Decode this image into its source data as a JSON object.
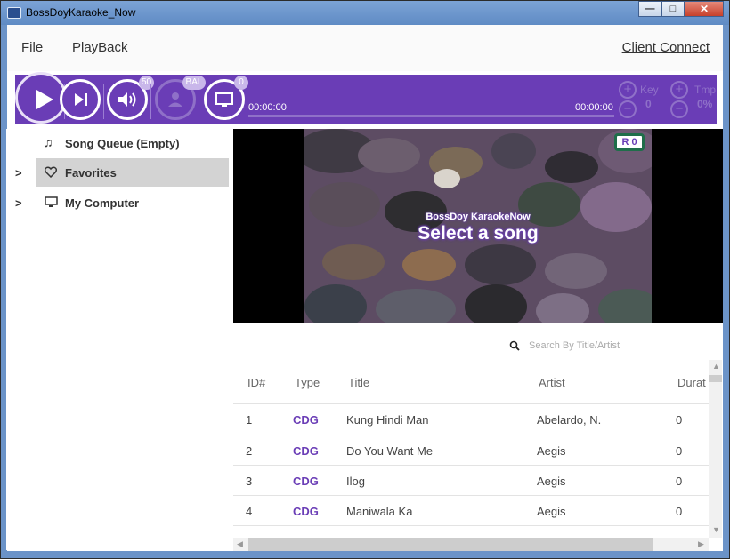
{
  "window": {
    "title": "BossDoyKaraoke_Now"
  },
  "menu": {
    "file": "File",
    "playback": "PlayBack",
    "client_connect": "Client Connect"
  },
  "player": {
    "volume_badge": "50",
    "balance_badge": "BAL",
    "display_badge": "0",
    "time_elapsed": "00:00:00",
    "time_total": "00:00:00",
    "key_label": "Key",
    "key_value": "0",
    "tempo_label": "Tmp",
    "tempo_value": "0%",
    "accent_color": "#6a3db6"
  },
  "sidebar": {
    "items": [
      {
        "label": "Song Queue (Empty)",
        "icon": "music-note-icon"
      },
      {
        "label": "Favorites",
        "icon": "heart-icon",
        "selected": true,
        "expand": ">"
      },
      {
        "label": "My Computer",
        "icon": "monitor-icon",
        "expand": ">"
      }
    ]
  },
  "video": {
    "badge": "R 0",
    "subtitle": "BossDoy KaraokeNow",
    "title": "Select a song"
  },
  "search": {
    "placeholder": "Search By Title/Artist"
  },
  "table": {
    "headers": [
      "ID#",
      "Type",
      "Title",
      "Artist",
      "Durat"
    ],
    "rows": [
      {
        "id": "1",
        "type": "CDG",
        "title": "Kung Hindi Man",
        "artist": "Abelardo, N.",
        "duration": "0"
      },
      {
        "id": "2",
        "type": "CDG",
        "title": "Do You Want Me",
        "artist": "Aegis",
        "duration": "0"
      },
      {
        "id": "3",
        "type": "CDG",
        "title": "Ilog",
        "artist": "Aegis",
        "duration": "0"
      },
      {
        "id": "4",
        "type": "CDG",
        "title": "Maniwala Ka",
        "artist": "Aegis",
        "duration": "0"
      }
    ]
  }
}
